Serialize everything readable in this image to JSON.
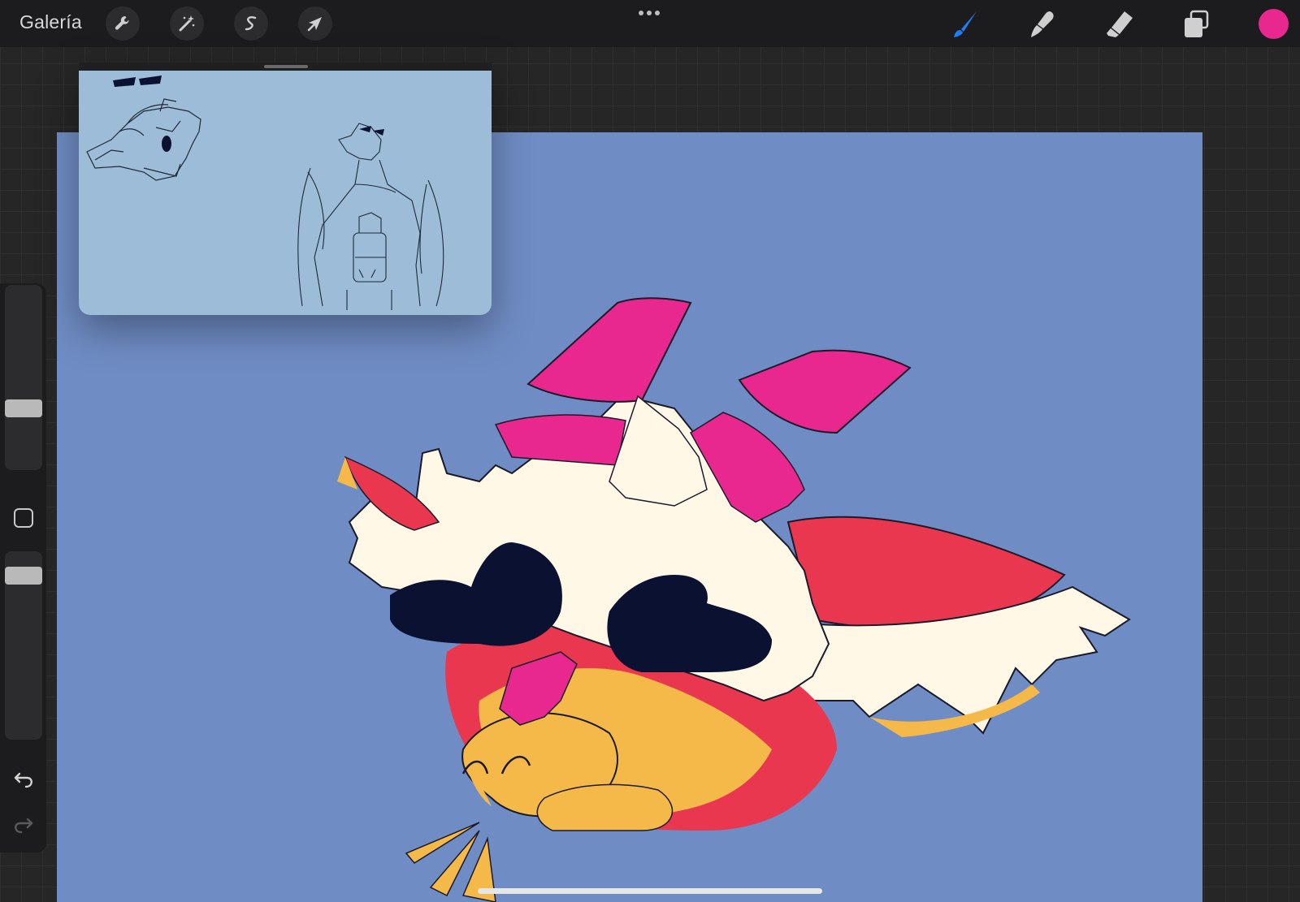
{
  "toolbar": {
    "gallery_label": "Galería",
    "left_tools": [
      {
        "name": "actions",
        "icon": "wrench-icon"
      },
      {
        "name": "adjustments",
        "icon": "magic-wand-icon"
      },
      {
        "name": "selection",
        "icon": "selection-s-icon"
      },
      {
        "name": "transform",
        "icon": "arrow-cursor-icon"
      }
    ],
    "center_menu_icon": "more-dots-icon",
    "right_tools": [
      {
        "name": "brush",
        "icon": "brush-icon",
        "active": true
      },
      {
        "name": "smudge",
        "icon": "smudge-finger-icon"
      },
      {
        "name": "eraser",
        "icon": "eraser-icon"
      },
      {
        "name": "layers",
        "icon": "layers-icon"
      }
    ],
    "active_tool_color": "#1f7cf2",
    "current_color": "#e8288f"
  },
  "sidebar": {
    "brush_size_level": 0.64,
    "opacity_level": 0.98,
    "modify_icon": "square-modify-icon",
    "undo_icon": "undo-icon",
    "redo_icon": "redo-icon"
  },
  "canvas": {
    "background": "#6f8cc4"
  },
  "reference": {
    "background": "#9dbcd8"
  }
}
